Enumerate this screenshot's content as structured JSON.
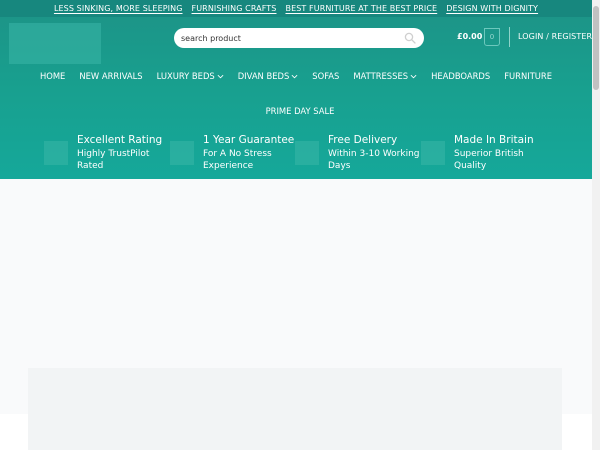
{
  "topbar": {
    "messages": [
      "LESS SINKING, MORE SLEEPING",
      "FURNISHING CRAFTS",
      "BEST FURNITURE AT THE BEST PRICE",
      "DESIGN WITH DIGNITY"
    ]
  },
  "header": {
    "search_placeholder": "search product",
    "cart_total": "£0.00",
    "cart_count": "0",
    "login_label": "LOGIN / REGISTER"
  },
  "nav": {
    "items": [
      {
        "label": "HOME"
      },
      {
        "label": "NEW ARRIVALS"
      },
      {
        "label": "LUXURY BEDS"
      },
      {
        "label": "DIVAN BEDS"
      },
      {
        "label": "SOFAS"
      },
      {
        "label": "MATTRESSES"
      },
      {
        "label": "HEADBOARDS"
      },
      {
        "label": "FURNITURE"
      }
    ],
    "row2": [
      {
        "label": "PRIME DAY SALE"
      }
    ]
  },
  "features": [
    {
      "title": "Excellent Rating",
      "subtitle": "Highly TrustPilot Rated"
    },
    {
      "title": "1 Year Guarantee",
      "subtitle": "For A No Stress Experience"
    },
    {
      "title": "Free Delivery",
      "subtitle": "Within 3-10 Working Days"
    },
    {
      "title": "Made In Britain",
      "subtitle": "Superior British Quality"
    }
  ],
  "colors": {
    "topbar": "#17877e",
    "header": "#18a08f",
    "text": "#ffffff"
  },
  "icons": [
    "search-icon",
    "chevron-down-icon",
    "cart-icon"
  ]
}
